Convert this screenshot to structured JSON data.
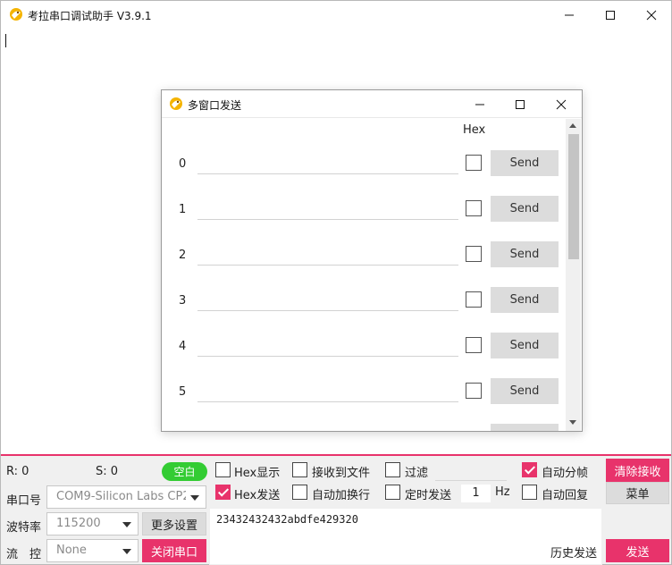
{
  "window": {
    "title": "考拉串口调试助手 V3.9.1",
    "receive_area_text": ""
  },
  "dialog": {
    "title": "多窗口发送",
    "hex_header": "Hex",
    "rows": [
      {
        "index": "0",
        "value": "",
        "hex": false,
        "send_label": "Send"
      },
      {
        "index": "1",
        "value": "",
        "hex": false,
        "send_label": "Send"
      },
      {
        "index": "2",
        "value": "",
        "hex": false,
        "send_label": "Send"
      },
      {
        "index": "3",
        "value": "",
        "hex": false,
        "send_label": "Send"
      },
      {
        "index": "4",
        "value": "",
        "hex": false,
        "send_label": "Send"
      },
      {
        "index": "5",
        "value": "",
        "hex": false,
        "send_label": "Send"
      }
    ]
  },
  "status": {
    "rx_label": "R: 0",
    "tx_label": "S: 0",
    "idle_badge": "空白"
  },
  "port": {
    "port_label": "串口号",
    "port_value": "COM9-Silicon Labs CP2",
    "baud_label": "波特率",
    "baud_value": "115200",
    "flow_label": "流　控",
    "flow_value": "None",
    "more_settings": "更多设置",
    "close_port": "关闭串口"
  },
  "options": {
    "hex_display": {
      "label": "Hex显示",
      "checked": false
    },
    "receive_to_file": {
      "label": "接收到文件",
      "checked": false
    },
    "filter": {
      "label": "过滤",
      "checked": false
    },
    "auto_frame": {
      "label": "自动分帧",
      "checked": true
    },
    "hex_send": {
      "label": "Hex发送",
      "checked": true
    },
    "auto_newline": {
      "label": "自动加换行",
      "checked": false
    },
    "timed_send": {
      "label": "定时发送",
      "checked": false
    },
    "timer_value": "1",
    "timer_unit": "Hz",
    "auto_reply": {
      "label": "自动回复",
      "checked": false
    }
  },
  "actions": {
    "clear_receive": "清除接收",
    "menu": "菜单",
    "history_send": "历史发送",
    "send": "发送"
  },
  "send_text": "23432432432abdfe429320",
  "colors": {
    "accent": "#e8336b",
    "badge_green": "#33cc33",
    "panel_bg": "#f0f0f0"
  }
}
